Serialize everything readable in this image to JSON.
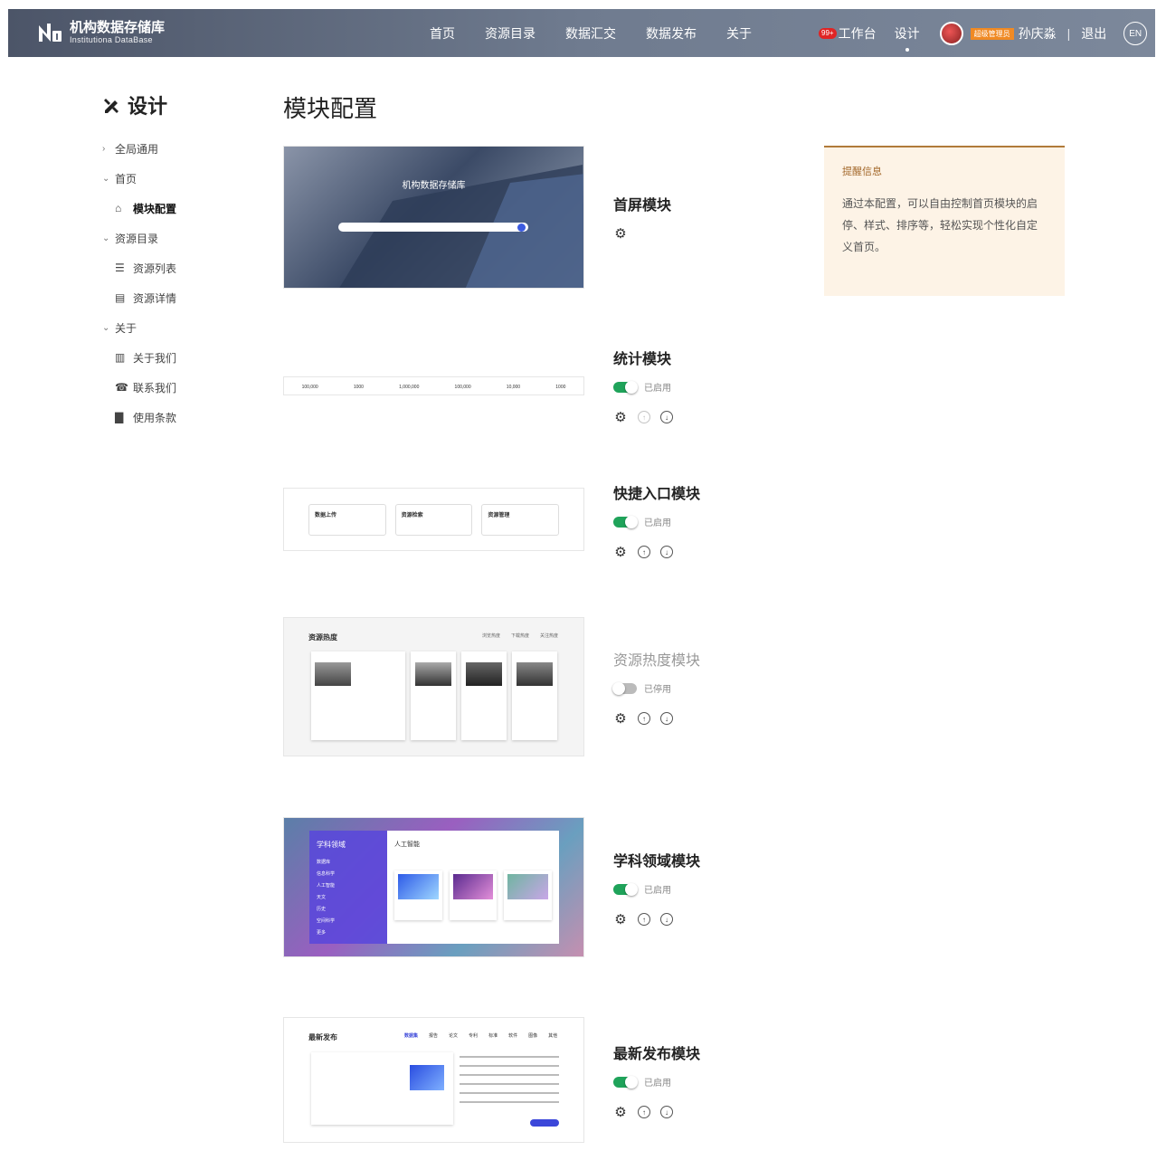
{
  "header": {
    "logo_title": "机构数据存储库",
    "logo_sub": "Institutiona DataBase",
    "nav": [
      "首页",
      "资源目录",
      "数据汇交",
      "数据发布",
      "关于"
    ],
    "badge": "99+",
    "workbench": "工作台",
    "design": "设计",
    "role": "超级管理员",
    "user": "孙庆淼",
    "sep": "|",
    "logout": "退出",
    "lang": "EN"
  },
  "sidebar": {
    "title": "设计",
    "groups": [
      {
        "label": "全局通用",
        "expanded": false,
        "items": []
      },
      {
        "label": "首页",
        "expanded": true,
        "items": [
          {
            "label": "模块配置",
            "icon": "home-icon",
            "active": true
          }
        ]
      },
      {
        "label": "资源目录",
        "expanded": true,
        "items": [
          {
            "label": "资源列表",
            "icon": "list-icon"
          },
          {
            "label": "资源详情",
            "icon": "doc-icon"
          }
        ]
      },
      {
        "label": "关于",
        "expanded": true,
        "items": [
          {
            "label": "关于我们",
            "icon": "building-icon"
          },
          {
            "label": "联系我们",
            "icon": "phone-icon"
          },
          {
            "label": "使用条款",
            "icon": "book-icon"
          }
        ]
      }
    ]
  },
  "page_title": "模块配置",
  "modules": [
    {
      "name": "首屏模块",
      "status": null,
      "enabled": true
    },
    {
      "name": "统计模块",
      "status": "已启用",
      "enabled": true
    },
    {
      "name": "快捷入口模块",
      "status": "已启用",
      "enabled": true
    },
    {
      "name": "资源热度模块",
      "status": "已停用",
      "enabled": false
    },
    {
      "name": "学科领域模块",
      "status": "已启用",
      "enabled": true
    },
    {
      "name": "最新发布模块",
      "status": "已启用",
      "enabled": true
    }
  ],
  "previews": {
    "hero_title": "机构数据存储库",
    "stats": [
      "100,000",
      "1000",
      "1,000,000",
      "100,000",
      "10,000",
      "1000"
    ],
    "quick": [
      "数据上传",
      "资源检索",
      "资源管理"
    ],
    "hot_title": "资源热度",
    "hot_tabs": [
      "浏览热度",
      "下载热度",
      "关注热度"
    ],
    "subject_title": "学科领域",
    "subject_sub": "人工智能",
    "subject_items": [
      "数据库",
      "信息科学",
      "人工智能",
      "天文",
      "历史",
      "空间科学",
      "更多"
    ],
    "latest_title": "最新发布",
    "latest_tabs": [
      "数据集",
      "报告",
      "论文",
      "专利",
      "标准",
      "软件",
      "图像",
      "其他"
    ]
  },
  "note": {
    "title": "提醒信息",
    "body": "通过本配置，可以自由控制首页模块的启停、样式、排序等，轻松实现个性化自定义首页。"
  },
  "colors": {
    "on": "#1fa35a",
    "off": "#bbbbbb",
    "note_bg": "#fdf3e6",
    "note_border": "#b07a3a"
  }
}
